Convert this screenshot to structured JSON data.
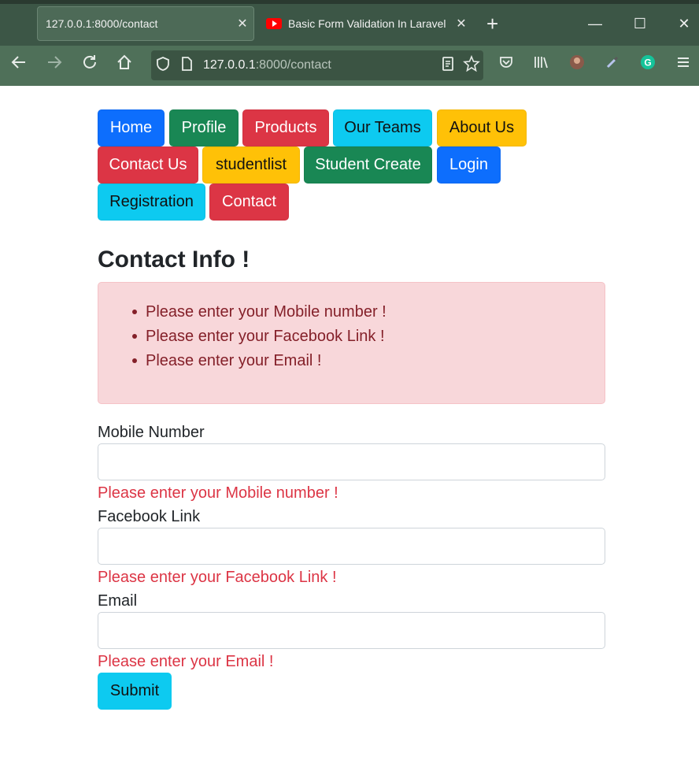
{
  "browser": {
    "tabs": [
      {
        "title": "127.0.0.1:8000/contact",
        "active": true
      },
      {
        "title": "Basic Form Validation In Laravel",
        "active": false
      }
    ],
    "url": {
      "host": "127.0.0.1",
      "path": ":8000/contact"
    }
  },
  "nav": {
    "home": "Home",
    "profile": "Profile",
    "products": "Products",
    "our_teams": "Our Teams",
    "about_us": "About Us",
    "contact_us": "Contact Us",
    "studentlist": "studentlist",
    "student_create": "Student Create",
    "login": "Login",
    "registration": "Registration",
    "contact": "Contact"
  },
  "page": {
    "title": "Contact Info !",
    "alert_errors": [
      "Please enter your Mobile number !",
      "Please enter your Facebook Link !",
      "Please enter your Email !"
    ],
    "fields": {
      "mobile": {
        "label": "Mobile Number",
        "value": "",
        "error": "Please enter your Mobile number !"
      },
      "facebook": {
        "label": "Facebook Link",
        "value": "",
        "error": "Please enter your Facebook Link !"
      },
      "email": {
        "label": "Email",
        "value": "",
        "error": "Please enter your Email !"
      }
    },
    "submit_label": "Submit"
  },
  "colors": {
    "primary": "#0d6efd",
    "success": "#198754",
    "danger": "#dc3545",
    "info": "#0dcaf0",
    "warning": "#ffc107",
    "alert_bg": "#f8d7da",
    "alert_text": "#842029"
  }
}
